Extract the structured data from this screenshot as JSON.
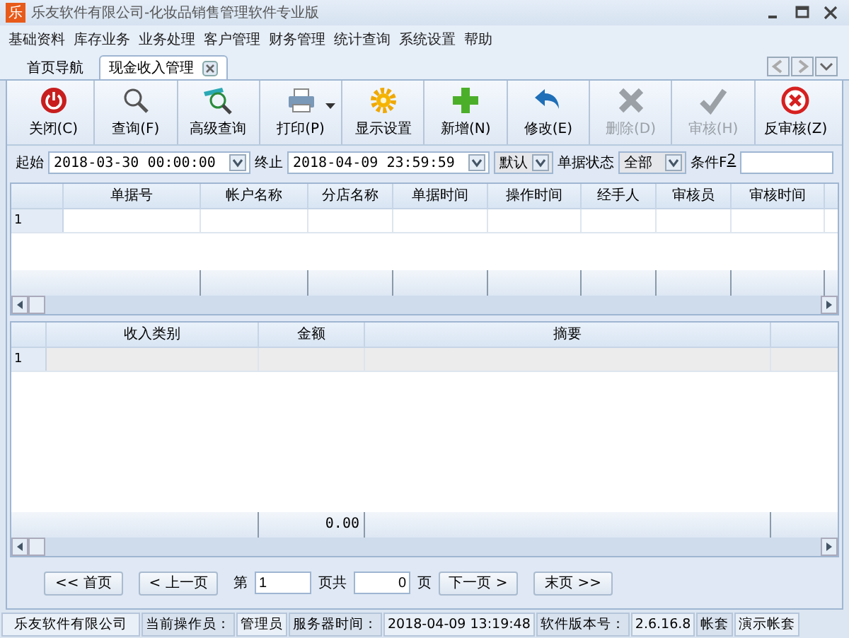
{
  "window": {
    "logo": "乐",
    "title": "乐友软件有限公司-化妆品销售管理软件专业版"
  },
  "menu": [
    "基础资料",
    "库存业务",
    "业务处理",
    "客户管理",
    "财务管理",
    "统计查询",
    "系统设置",
    "帮助"
  ],
  "tabs": [
    {
      "label": "首页导航",
      "selected": false,
      "closable": false
    },
    {
      "label": "现金收入管理",
      "selected": true,
      "closable": true
    }
  ],
  "toolbar": [
    {
      "kind": "power",
      "label": "关闭(C)",
      "disabled": false,
      "dropdown": false
    },
    {
      "kind": "search",
      "label": "查询(F)",
      "disabled": false,
      "dropdown": false
    },
    {
      "kind": "advanced",
      "label": "高级查询",
      "disabled": false,
      "dropdown": false
    },
    {
      "kind": "print",
      "label": "打印(P)",
      "disabled": false,
      "dropdown": true
    },
    {
      "kind": "gear",
      "label": "显示设置",
      "disabled": false,
      "dropdown": false
    },
    {
      "kind": "add",
      "label": "新增(N)",
      "disabled": false,
      "dropdown": false
    },
    {
      "kind": "undo",
      "label": "修改(E)",
      "disabled": false,
      "dropdown": false
    },
    {
      "kind": "delete",
      "label": "删除(D)",
      "disabled": true,
      "dropdown": false
    },
    {
      "kind": "check",
      "label": "审核(H)",
      "disabled": true,
      "dropdown": false
    },
    {
      "kind": "uncheck",
      "label": "反审核(Z)",
      "disabled": false,
      "dropdown": false
    }
  ],
  "filter": {
    "start_label": "起始",
    "start": "2018-03-30 00:00:00",
    "end_label": "终止",
    "end": "2018-04-09 23:59:59",
    "mode": "默认",
    "status_label": "单据状态",
    "status": "全部",
    "condition_label": "条件F",
    "condition_key": "2"
  },
  "upper_table": {
    "columns": [
      "单据号",
      "帐户名称",
      "分店名称",
      "单据时间",
      "操作时间",
      "经手人",
      "审核员",
      "审核时间"
    ],
    "rows": [
      {
        "number": "1"
      }
    ]
  },
  "lower_table": {
    "columns": [
      "收入类别",
      "金额",
      "摘要"
    ],
    "rows": [
      {
        "number": "1"
      }
    ],
    "total_amount": "0.00"
  },
  "pagination": {
    "first": "<< 首页",
    "prev": "< 上一页",
    "page_label": "第",
    "page": "1",
    "total_label": "页共",
    "total": "0",
    "page_suffix": "页",
    "next": "下一页 >",
    "last": "末页 >>"
  },
  "status_bar": [
    {
      "kind": "value",
      "text": "乐友软件有限公司"
    },
    {
      "kind": "label",
      "text": "当前操作员："
    },
    {
      "kind": "value",
      "text": "管理员"
    },
    {
      "kind": "label",
      "text": "服务器时间："
    },
    {
      "kind": "value",
      "text": "2018-04-09 13:19:48"
    },
    {
      "kind": "label",
      "text": "软件版本号："
    },
    {
      "kind": "value",
      "text": "2.6.16.8"
    },
    {
      "kind": "label",
      "text": "帐套"
    },
    {
      "kind": "value",
      "text": "演示帐套"
    }
  ]
}
